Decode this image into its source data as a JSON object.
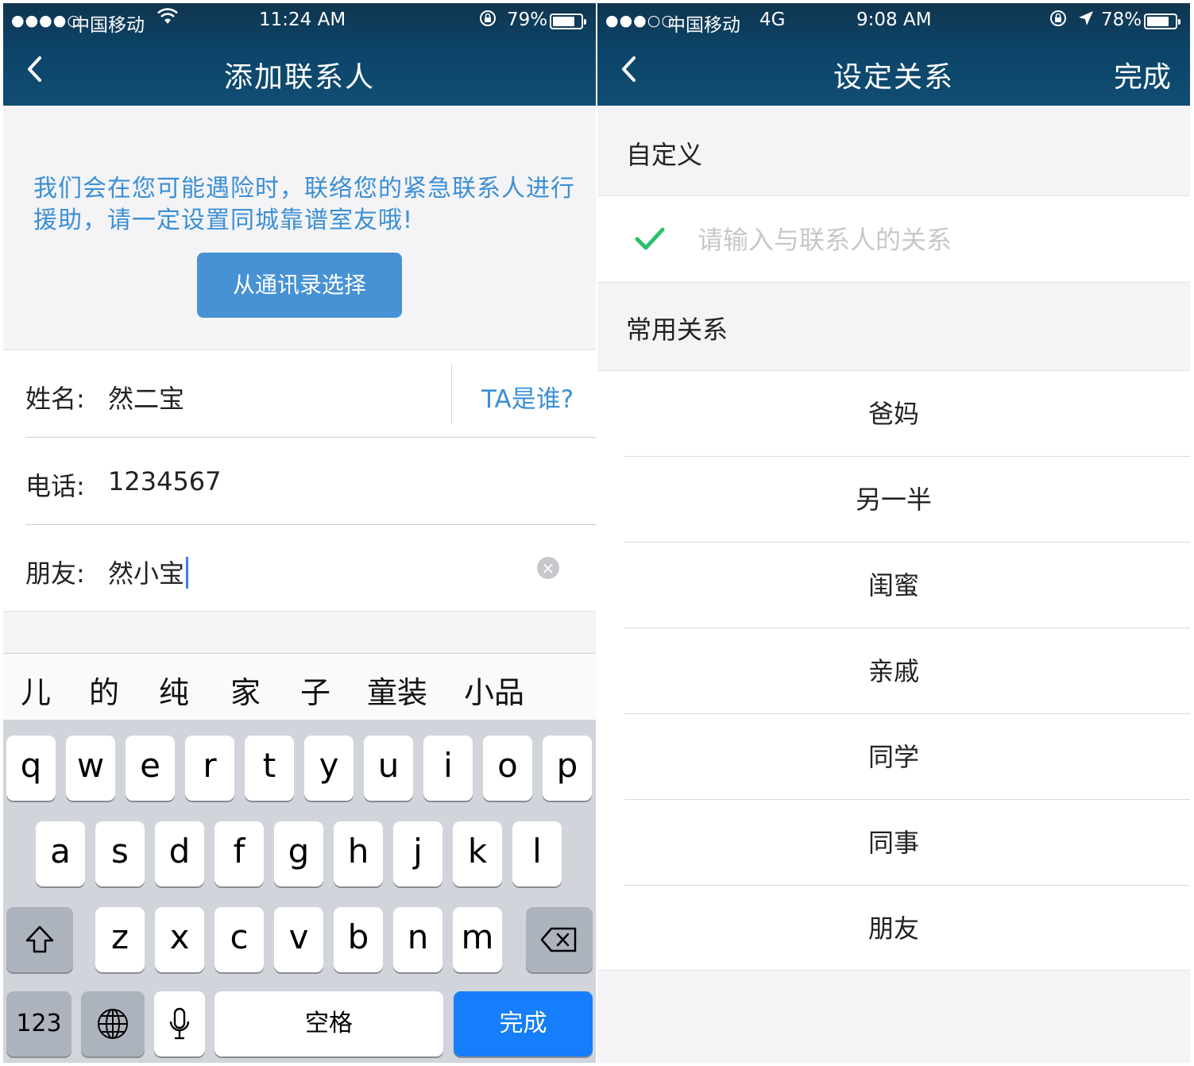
{
  "left_screen": {
    "status": {
      "signal": "●●●●○",
      "carrier": "中国移动",
      "time": "11:24 AM",
      "battery": "79%",
      "battery_level": 0.79
    },
    "nav": {
      "title": "添加联系人"
    },
    "notice": "我们会在您可能遇险时，联络您的紧急联系人进行援助，请一定设置同城靠谱室友哦!",
    "contacts_button": "从通讯录选择",
    "form": {
      "name_label": "姓名:",
      "name_value": "然二宝",
      "who_link": "TA是谁?",
      "phone_label": "电话:",
      "phone_value": "1234567",
      "relation_label": "朋友:",
      "relation_value": "然小宝"
    },
    "suggestions": [
      "儿",
      "的",
      "纯",
      "家",
      "子",
      "童装",
      "小品"
    ],
    "keyboard": {
      "row1": [
        "q",
        "w",
        "e",
        "r",
        "t",
        "y",
        "u",
        "i",
        "o",
        "p"
      ],
      "row2": [
        "a",
        "s",
        "d",
        "f",
        "g",
        "h",
        "j",
        "k",
        "l"
      ],
      "row3": [
        "z",
        "x",
        "c",
        "v",
        "b",
        "n",
        "m"
      ],
      "numbers_key": "123",
      "space_key": "空格",
      "done_key": "完成"
    }
  },
  "right_screen": {
    "status": {
      "signal": "●●●○○",
      "carrier": "中国移动",
      "network": "4G",
      "time": "9:08 AM",
      "battery": "78%",
      "battery_level": 0.78
    },
    "nav": {
      "title": "设定关系",
      "done": "完成"
    },
    "custom_section": "自定义",
    "custom_placeholder": "请输入与联系人的关系",
    "common_section": "常用关系",
    "relations": [
      "爸妈",
      "另一半",
      "闺蜜",
      "亲戚",
      "同学",
      "同事",
      "朋友"
    ]
  },
  "colors": {
    "nav_bg": "#0c4468",
    "accent_blue": "#3b8fd6",
    "button_blue": "#4792d4",
    "keyboard_done": "#167efb",
    "check_green": "#2bbf6b"
  }
}
